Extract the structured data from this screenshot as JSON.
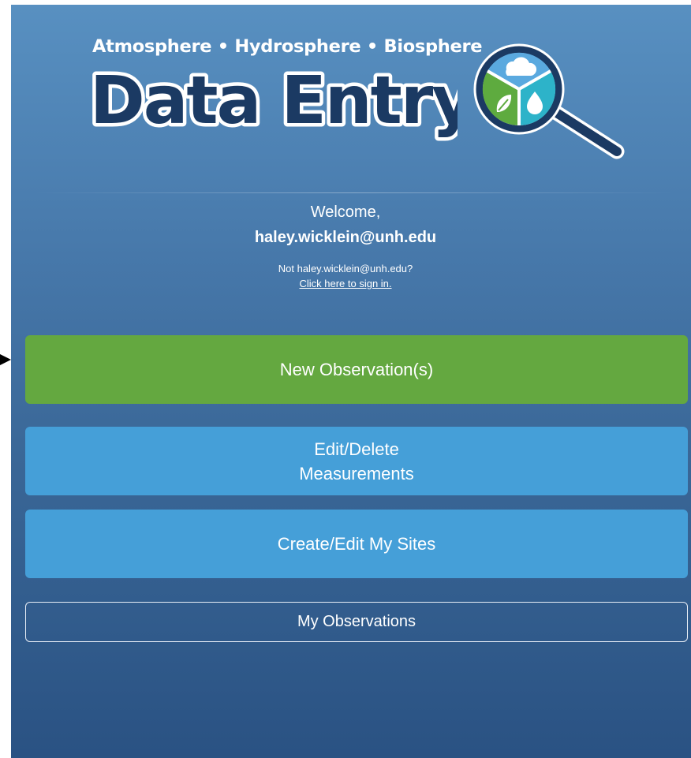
{
  "header": {
    "tagline": "Atmosphere • Hydrosphere • Biosphere",
    "wordmark": "Data Entry",
    "logo_icon": "magnifier-with-cloud-leaf-drop-icon"
  },
  "welcome": {
    "greeting": "Welcome,",
    "email": "haley.wicklein@unh.edu",
    "not_you": "Not haley.wicklein@unh.edu?",
    "signin_link": "Click here to sign in."
  },
  "buttons": {
    "new_observation": "New Observation(s)",
    "edit_delete_line1": "Edit/Delete",
    "edit_delete_line2": "Measurements",
    "create_edit_sites": "Create/Edit My Sites",
    "my_observations": "My Observations"
  },
  "colors": {
    "background_top": "#5890c1",
    "background_bottom": "#2a5283",
    "primary_green": "#64a840",
    "secondary_blue": "#459fd8",
    "wordmark_fill": "#1b3a63"
  }
}
